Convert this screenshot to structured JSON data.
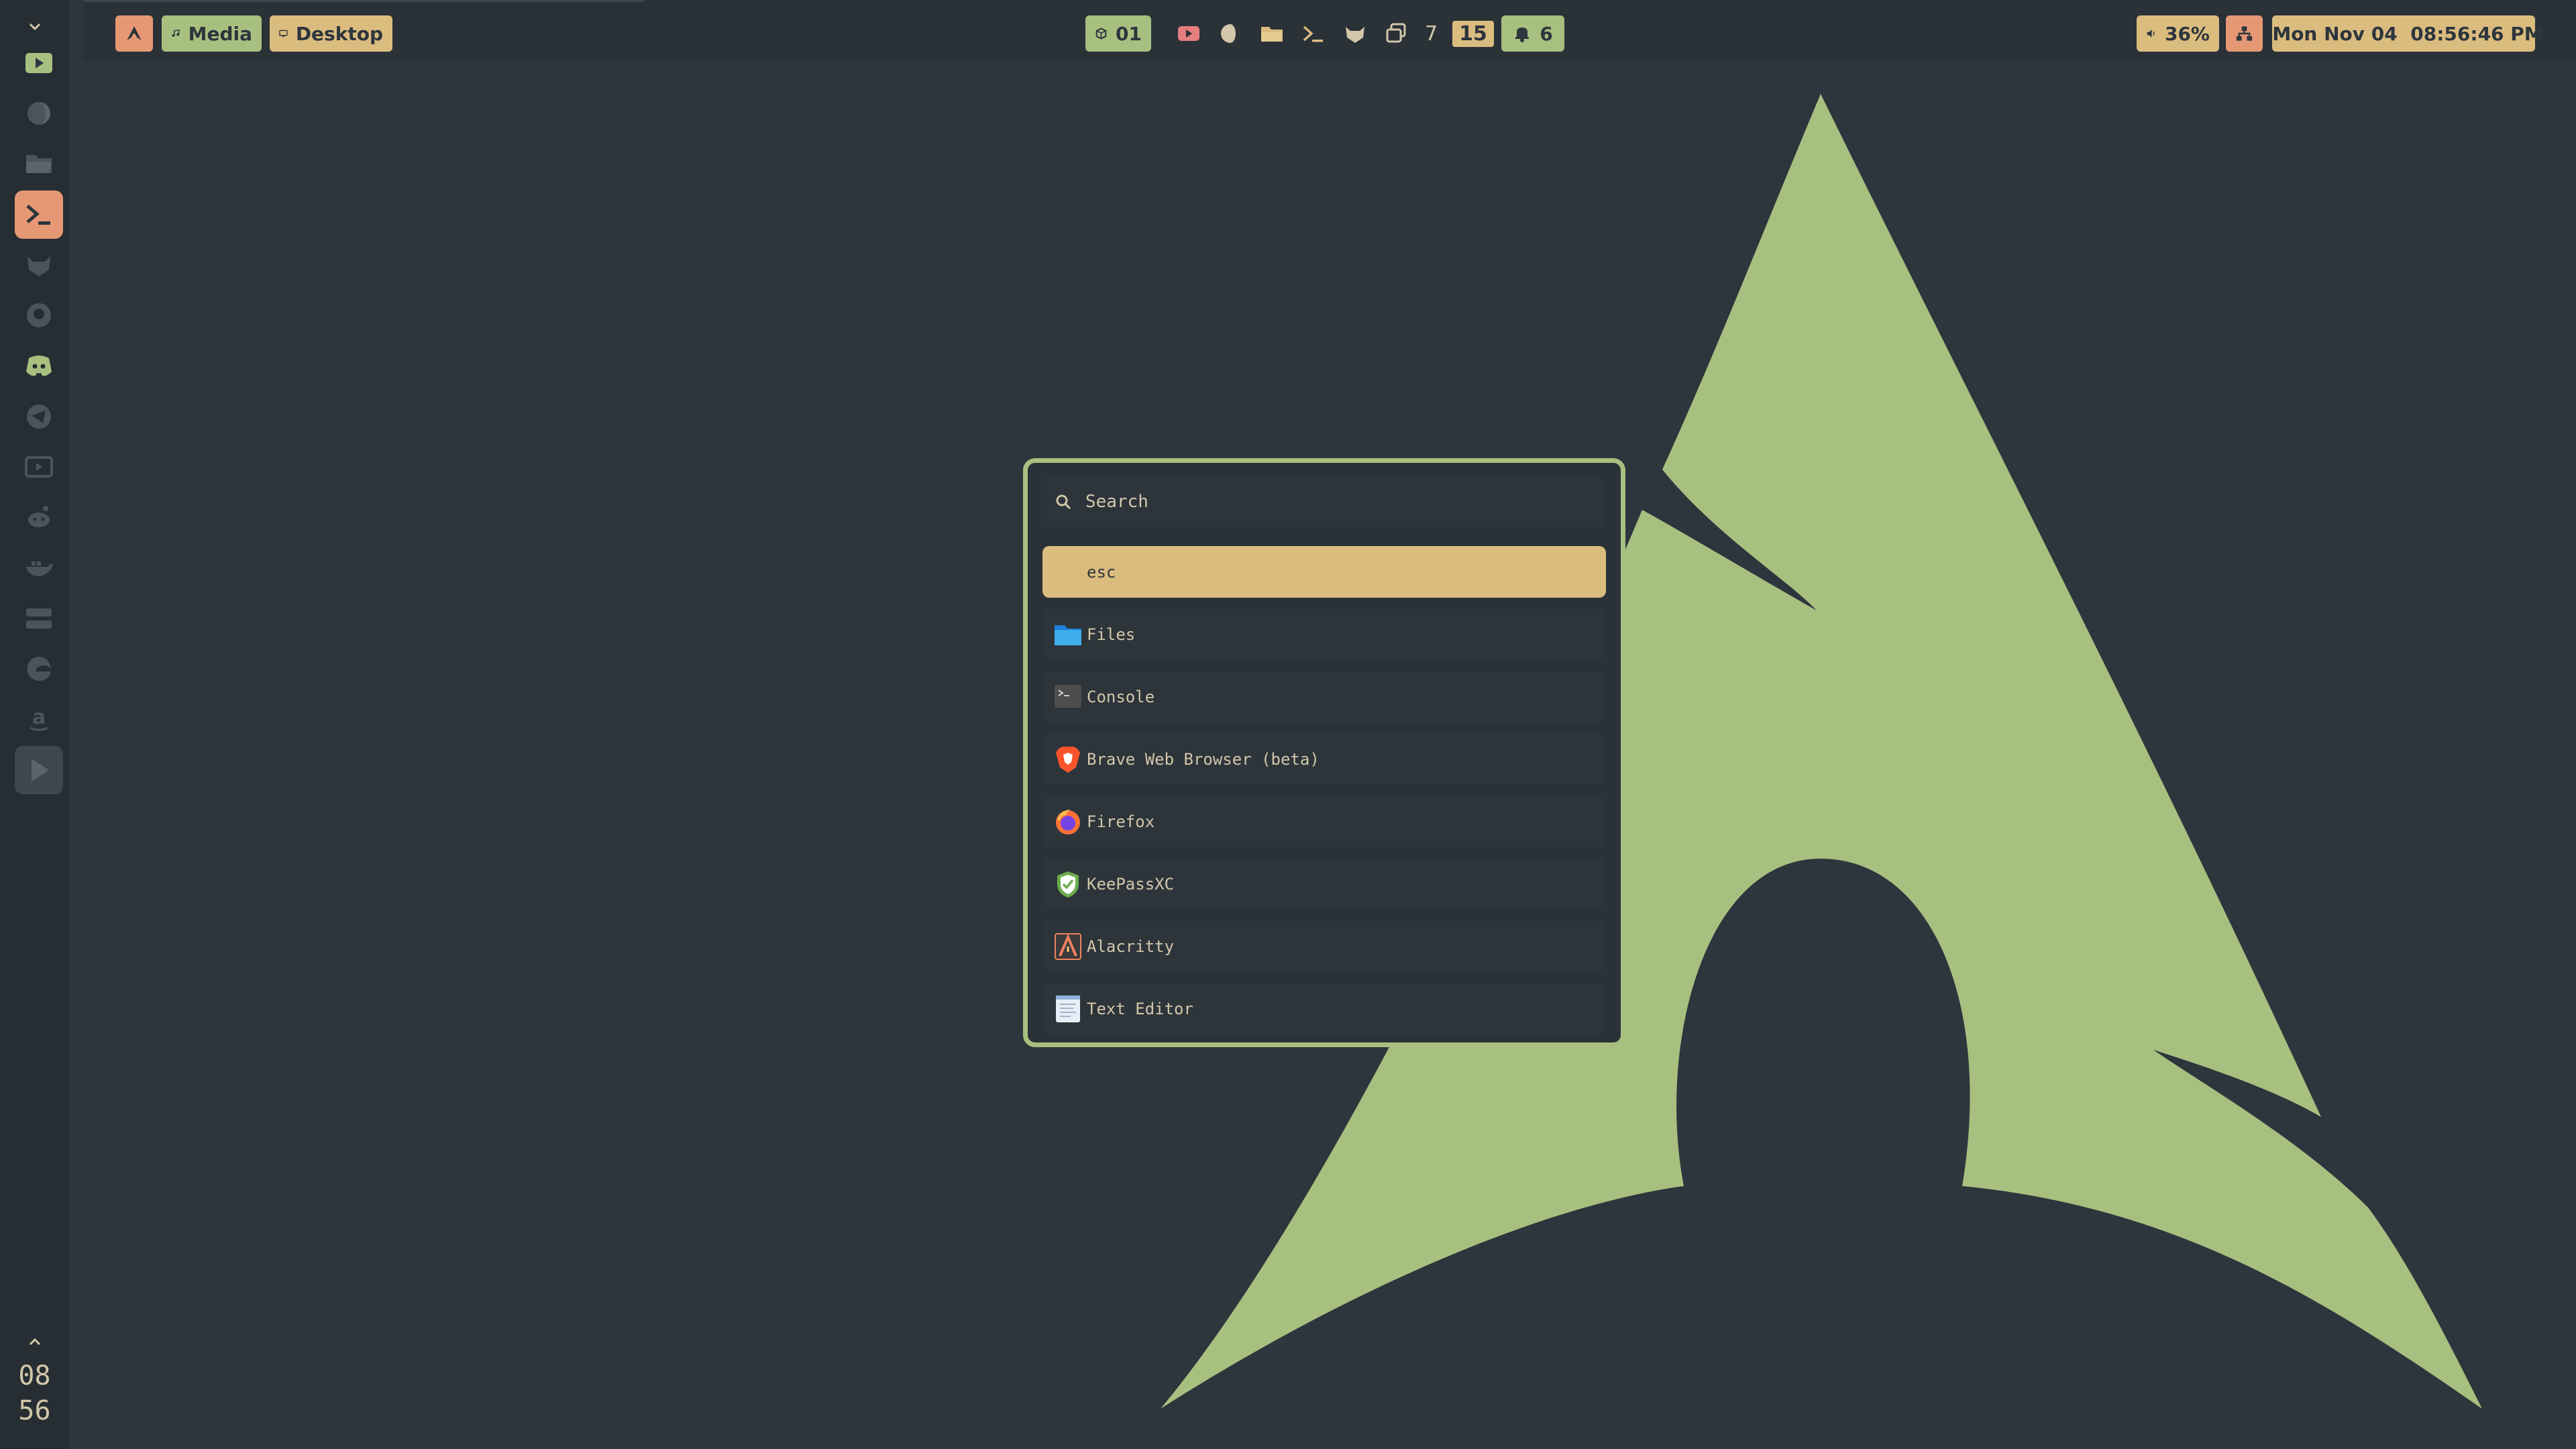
{
  "colors": {
    "background": "#2e353c",
    "accent_green": "#a7c080",
    "accent_yellow": "#dbbc7f",
    "accent_red": "#e69875",
    "text": "#d3c6aa"
  },
  "dock": {
    "items": [
      {
        "name": "media-player",
        "icon": "play-square-icon",
        "active": false
      },
      {
        "name": "dark-mode",
        "icon": "half-moon-icon",
        "active": false
      },
      {
        "name": "files",
        "icon": "folder-icon",
        "active": false
      },
      {
        "name": "terminal",
        "icon": "terminal-icon",
        "active": true
      },
      {
        "name": "gitlab",
        "icon": "fox-icon",
        "active": false
      },
      {
        "name": "github",
        "icon": "github-icon",
        "active": false
      },
      {
        "name": "discord",
        "icon": "discord-icon",
        "active": false
      },
      {
        "name": "telegram",
        "icon": "telegram-icon",
        "active": false
      },
      {
        "name": "youtube",
        "icon": "youtube-icon",
        "active": false
      },
      {
        "name": "reddit",
        "icon": "reddit-icon",
        "active": false
      },
      {
        "name": "docker",
        "icon": "whale-icon",
        "active": false
      },
      {
        "name": "server",
        "icon": "server-icon",
        "active": false
      },
      {
        "name": "edge",
        "icon": "edge-icon",
        "active": false
      },
      {
        "name": "amazon",
        "icon": "amazon-icon",
        "active": false
      },
      {
        "name": "video",
        "icon": "play-button-icon",
        "active": false
      }
    ],
    "clock": {
      "hours": "08",
      "minutes": "56"
    }
  },
  "topbar": {
    "left": [
      {
        "label": "",
        "icon": "arch-logo-icon"
      },
      {
        "label": "Media",
        "icon": "music-note-icon"
      },
      {
        "label": "Desktop",
        "icon": "monitor-icon"
      }
    ],
    "workspace": {
      "label": "01",
      "icon": "cube-icon"
    },
    "tray": {
      "icons": [
        "youtube-icon",
        "half-moon-icon",
        "folder-icon",
        "terminal-icon",
        "fox-icon",
        "windows-icon"
      ],
      "window_count": "7",
      "highlight_count": "15"
    },
    "notifications": {
      "label": "6",
      "icon": "bell-icon"
    },
    "volume": {
      "label": "36%",
      "icon": "speaker-icon"
    },
    "network": {
      "icon": "network-icon"
    },
    "datetime": {
      "label": "Mon Nov 04  08:56:46 PM",
      "icon": "calendar-icon"
    }
  },
  "launcher": {
    "search_placeholder": "Search",
    "entries": [
      {
        "label": "esc",
        "icon": "",
        "selected": true
      },
      {
        "label": "Files",
        "icon": "folder-icon"
      },
      {
        "label": "Console",
        "icon": "console-icon"
      },
      {
        "label": "Brave Web Browser (beta)",
        "icon": "brave-icon"
      },
      {
        "label": "Firefox",
        "icon": "firefox-icon"
      },
      {
        "label": "KeePassXC",
        "icon": "keepassxc-icon"
      },
      {
        "label": "Alacritty",
        "icon": "alacritty-icon"
      },
      {
        "label": "Text Editor",
        "icon": "text-editor-icon"
      }
    ]
  }
}
